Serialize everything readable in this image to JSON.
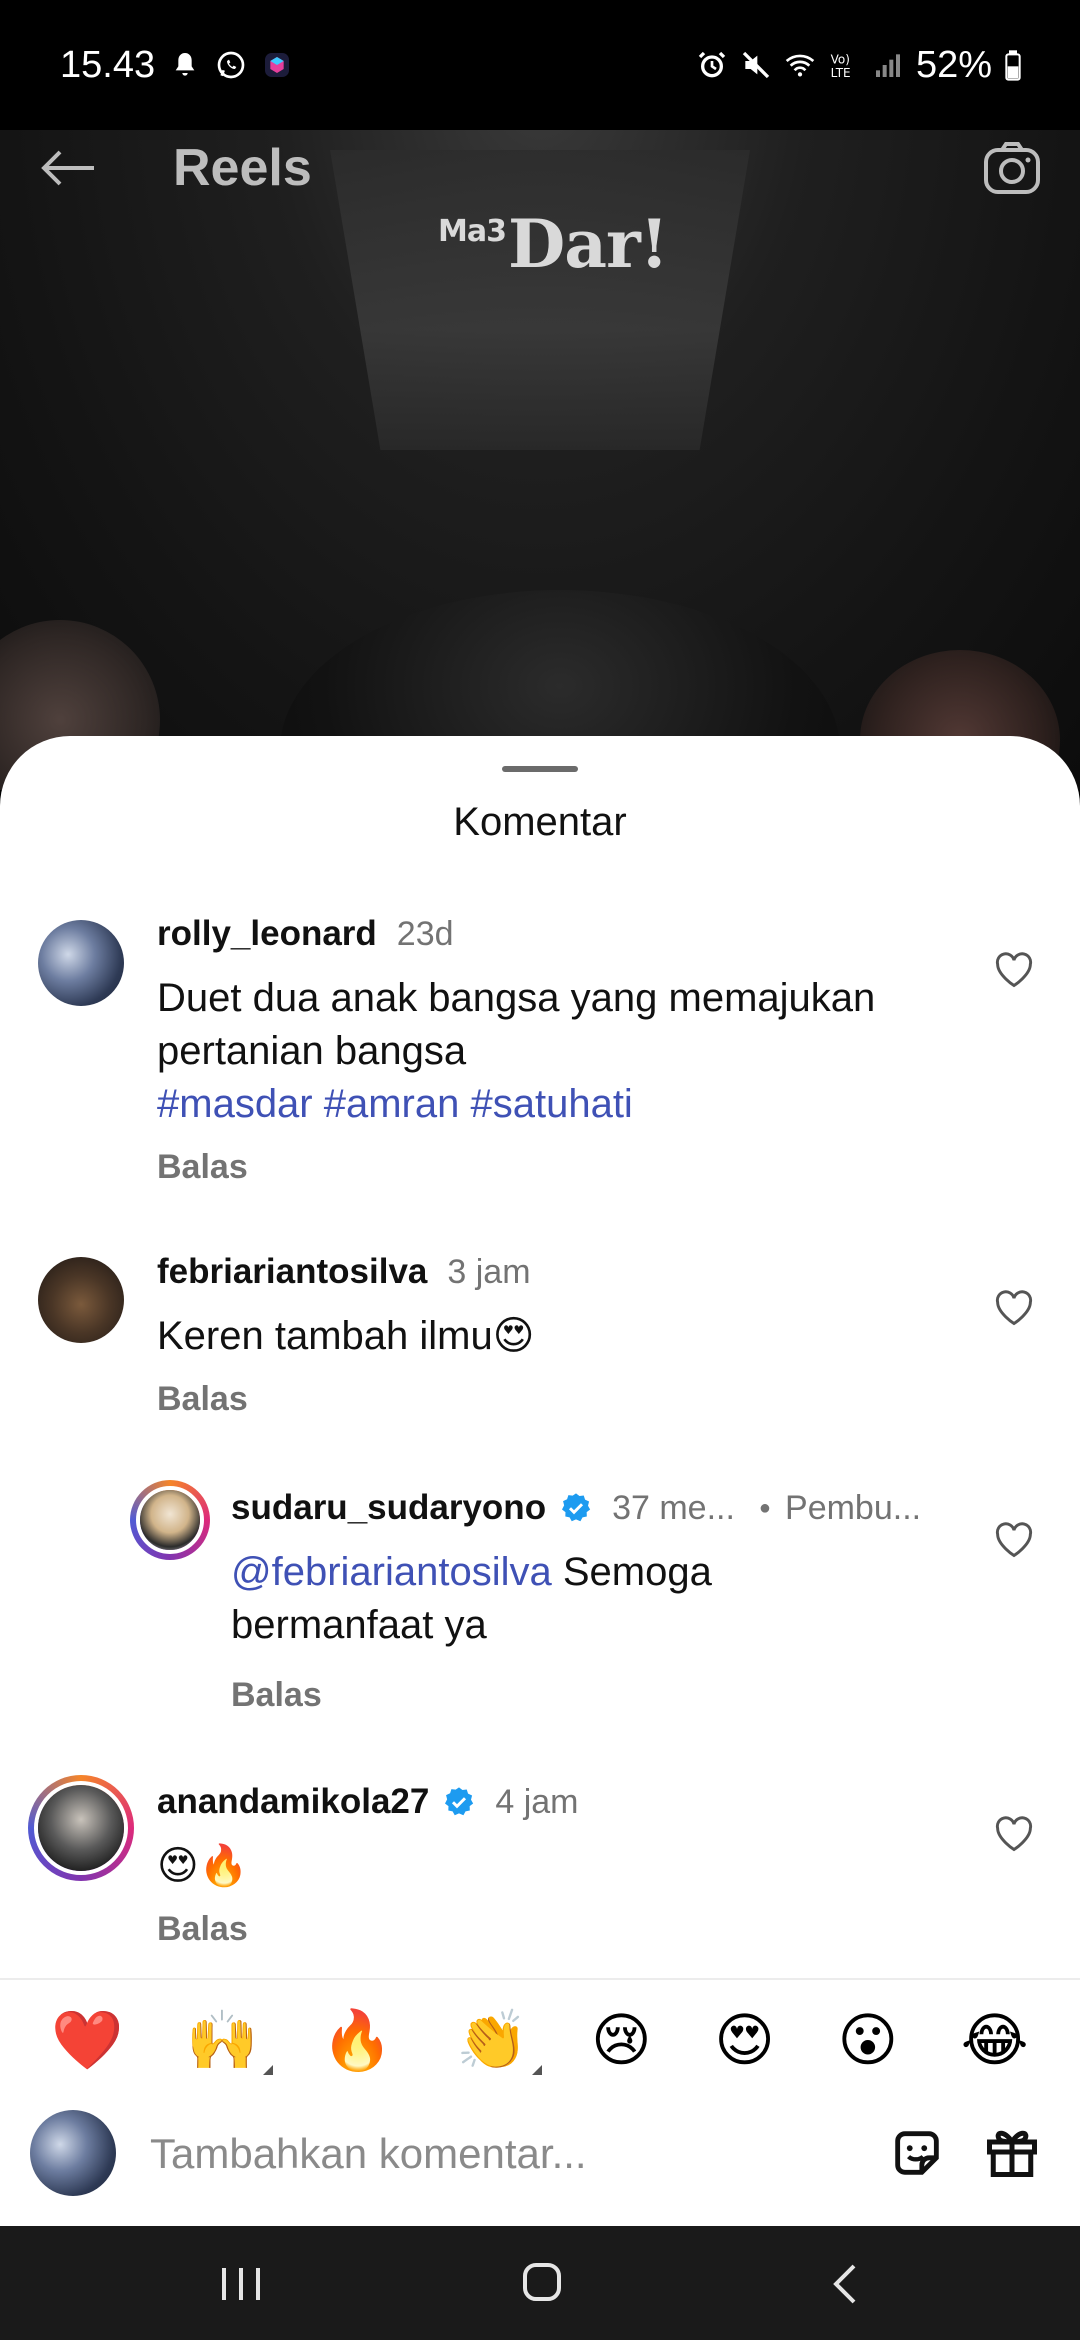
{
  "status_bar": {
    "time": "15.43",
    "battery": "52%",
    "icons_left": [
      "bell-icon",
      "whatsapp-icon",
      "app-icon"
    ],
    "icons_right": [
      "alarm-icon",
      "mute-icon",
      "wifi-icon",
      "volte-icon",
      "signal-icon",
      "battery-icon"
    ]
  },
  "header": {
    "title": "Reels",
    "watermark_prefix": "Ma3",
    "watermark": "Dar!"
  },
  "sheet": {
    "title": "Komentar"
  },
  "comments": [
    {
      "username": "rolly_leonard",
      "time": "23d",
      "text": "Duet dua anak bangsa yang memajukan pertanian bangsa",
      "tags": "#masdar #amran #satuhati",
      "reply_label": "Balas"
    },
    {
      "username": "febriariantosilva",
      "time": "3 jam",
      "text": "Keren tambah ilmu😍",
      "reply_label": "Balas"
    },
    {
      "username": "sudaru_sudaryono",
      "time": "37 me...",
      "badge": "Pembu...",
      "mention": "@febriariantosilva",
      "text": " Semoga bermanfaat ya",
      "reply_label": "Balas",
      "verified": true
    },
    {
      "username": "anandamikola27",
      "time": "4 jam",
      "text": "😍🔥",
      "reply_label": "Balas",
      "verified": true
    }
  ],
  "emoji_bar": [
    "❤️",
    "🙌",
    "🔥",
    "👏",
    "😢",
    "😍",
    "😮",
    "😂"
  ],
  "input": {
    "placeholder": "Tambahkan komentar..."
  },
  "colors": {
    "accent_link": "#3f51b5",
    "verified_blue": "#1d9bf0",
    "muted_text": "#737373"
  }
}
